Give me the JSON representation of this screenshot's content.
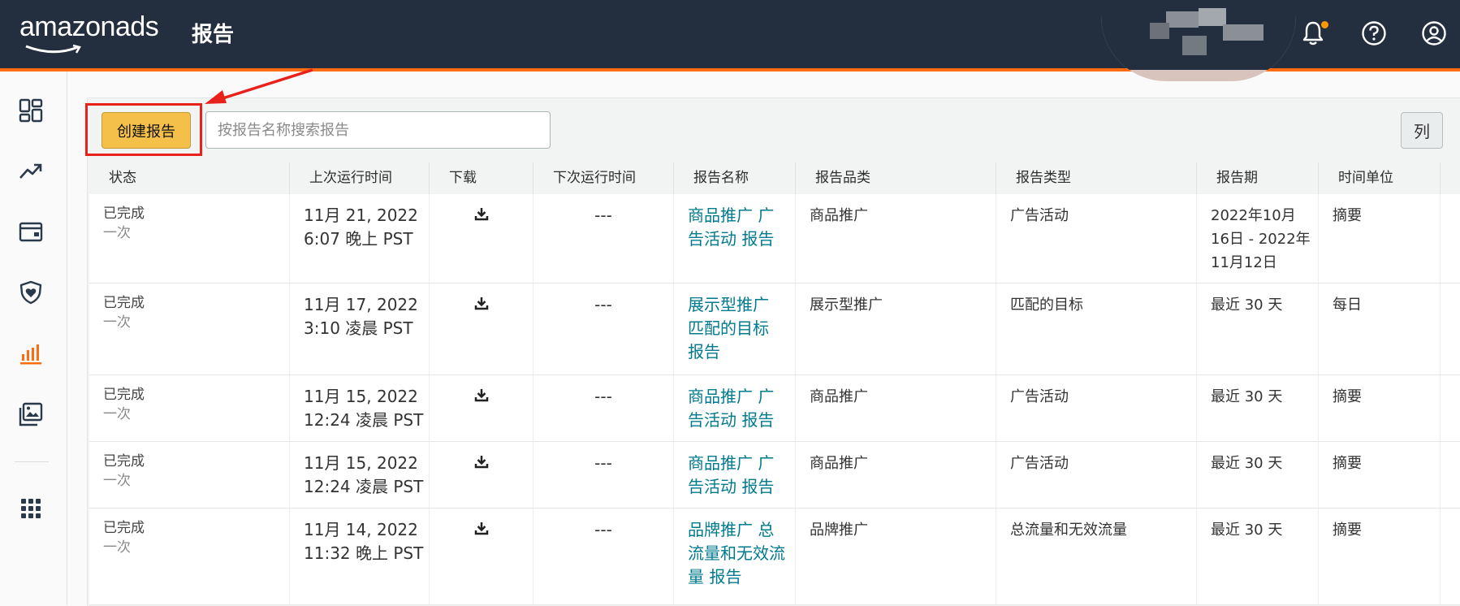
{
  "header": {
    "logo": "amazonads",
    "title": "报告",
    "accent": "#ff6b10"
  },
  "toolbar": {
    "create_label": "创建报告",
    "search_placeholder": "按报告名称搜索报告",
    "columns_label": "列"
  },
  "table": {
    "headers": [
      "状态",
      "上次运行时间",
      "下载",
      "下次运行时间",
      "报告名称",
      "报告品类",
      "报告类型",
      "报告期",
      "时间单位"
    ],
    "rows": [
      {
        "status": "已完成",
        "frequency": "一次",
        "last_run_1": "11月 21, 2022",
        "last_run_2": "6:07 晚上 PST",
        "next_run": "---",
        "name": "商品推广 广告活动 报告",
        "category": "商品推广",
        "type": "广告活动",
        "period": "2022年10月16日 - 2022年11月12日",
        "unit": "摘要"
      },
      {
        "status": "已完成",
        "frequency": "一次",
        "last_run_1": "11月 17, 2022",
        "last_run_2": "3:10 凌晨 PST",
        "next_run": "---",
        "name": "展示型推广 匹配的目标 报告",
        "category": "展示型推广",
        "type": "匹配的目标",
        "period": "最近 30 天",
        "unit": "每日"
      },
      {
        "status": "已完成",
        "frequency": "一次",
        "last_run_1": "11月 15, 2022",
        "last_run_2": "12:24 凌晨 PST",
        "next_run": "---",
        "name": "商品推广 广告活动 报告",
        "category": "商品推广",
        "type": "广告活动",
        "period": "最近 30 天",
        "unit": "摘要"
      },
      {
        "status": "已完成",
        "frequency": "一次",
        "last_run_1": "11月 15, 2022",
        "last_run_2": "12:24 凌晨 PST",
        "next_run": "---",
        "name": "商品推广 广告活动 报告",
        "category": "商品推广",
        "type": "广告活动",
        "period": "最近 30 天",
        "unit": "摘要"
      },
      {
        "status": "已完成",
        "frequency": "一次",
        "last_run_1": "11月 14, 2022",
        "last_run_2": "11:32 晚上 PST",
        "next_run": "---",
        "name": "品牌推广 总流量和无效流量 报告",
        "category": "品牌推广",
        "type": "总流量和无效流量",
        "period": "最近 30 天",
        "unit": "摘要"
      }
    ]
  },
  "sidebar": {
    "icons": [
      "dashboard-icon",
      "trend-icon",
      "wallet-icon",
      "shield-heart-icon",
      "bar-chart-icon",
      "media-library-icon",
      "apps-grid-icon"
    ]
  }
}
